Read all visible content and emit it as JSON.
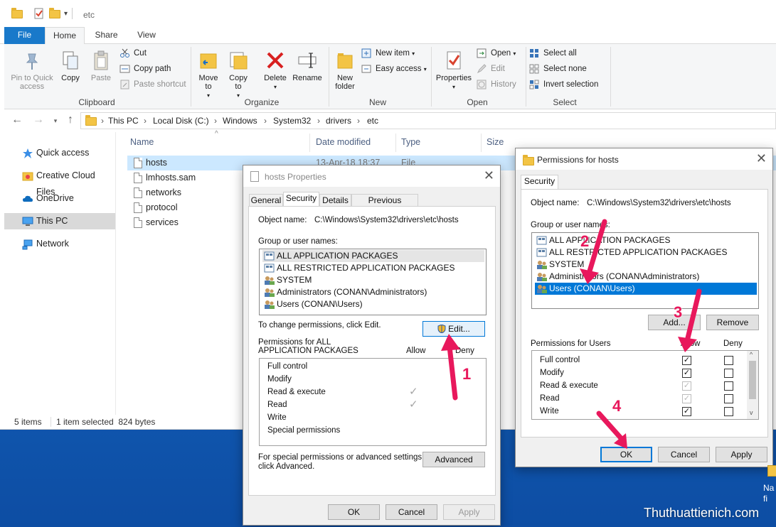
{
  "titlebar": {
    "path_text": "etc"
  },
  "ribbon_tabs": [
    "File",
    "Home",
    "Share",
    "View"
  ],
  "clipboard": {
    "pin_label": "Pin to Quick access",
    "copy_label": "Copy",
    "paste_label": "Paste",
    "cut_label": "Cut",
    "copy_path_label": "Copy path",
    "paste_shortcut_label": "Paste shortcut",
    "group_label": "Clipboard"
  },
  "organize": {
    "move_to_label": "Move to",
    "copy_to_label": "Copy to",
    "delete_label": "Delete",
    "rename_label": "Rename",
    "group_label": "Organize"
  },
  "new_group": {
    "new_folder_label": "New folder",
    "new_item_label": "New item",
    "easy_access_label": "Easy access",
    "group_label": "New"
  },
  "open_group": {
    "properties_label": "Properties",
    "open_label": "Open",
    "edit_label": "Edit",
    "history_label": "History",
    "group_label": "Open"
  },
  "select_group": {
    "select_all_label": "Select all",
    "select_none_label": "Select none",
    "invert_label": "Invert selection",
    "group_label": "Select"
  },
  "breadcrumb": [
    "This PC",
    "Local Disk (C:)",
    "Windows",
    "System32",
    "drivers",
    "etc"
  ],
  "nav": [
    {
      "label": "Quick access"
    },
    {
      "label": "Creative Cloud Files"
    },
    {
      "label": "OneDrive"
    },
    {
      "label": "This PC"
    },
    {
      "label": "Network"
    }
  ],
  "columns": {
    "name": "Name",
    "date": "Date modified",
    "type": "Type",
    "size": "Size"
  },
  "files": [
    {
      "name": "hosts",
      "date": "13-Apr-18 18:37",
      "type": "File"
    },
    {
      "name": "lmhosts.sam"
    },
    {
      "name": "networks"
    },
    {
      "name": "protocol"
    },
    {
      "name": "services"
    }
  ],
  "status": {
    "items": "5 items",
    "selection": "1 item selected  824 bytes"
  },
  "props_dialog": {
    "title": "hosts Properties",
    "tabs": [
      "General",
      "Security",
      "Details",
      "Previous Versions"
    ],
    "object_label": "Object name:",
    "object_value": "C:\\Windows\\System32\\drivers\\etc\\hosts",
    "group_label": "Group or user names:",
    "users": [
      "ALL APPLICATION PACKAGES",
      "ALL RESTRICTED APPLICATION PACKAGES",
      "SYSTEM",
      "Administrators (CONAN\\Administrators)",
      "Users (CONAN\\Users)"
    ],
    "change_text": "To change permissions, click Edit.",
    "edit_label": "Edit...",
    "perm_label_1": "Permissions for ALL",
    "perm_label_2": "APPLICATION PACKAGES",
    "allow_label": "Allow",
    "deny_label": "Deny",
    "perms": [
      "Full control",
      "Modify",
      "Read & execute",
      "Read",
      "Write",
      "Special permissions"
    ],
    "special_text_1": "For special permissions or advanced settings,",
    "special_text_2": "click Advanced.",
    "advanced_label": "Advanced",
    "ok_label": "OK",
    "cancel_label": "Cancel",
    "apply_label": "Apply"
  },
  "perm_dialog": {
    "title": "Permissions for hosts",
    "tab": "Security",
    "object_label": "Object name:",
    "object_value": "C:\\Windows\\System32\\drivers\\etc\\hosts",
    "group_label": "Group or user names:",
    "users": [
      "ALL APPLICATION PACKAGES",
      "ALL RESTRICTED APPLICATION PACKAGES",
      "SYSTEM",
      "Administrators (CONAN\\Administrators)",
      "Users (CONAN\\Users)"
    ],
    "add_label": "Add...",
    "remove_label": "Remove",
    "perm_label": "Permissions for Users",
    "allow_label": "Allow",
    "deny_label": "Deny",
    "perms": [
      "Full control",
      "Modify",
      "Read & execute",
      "Read",
      "Write"
    ],
    "ok_label": "OK",
    "cancel_label": "Cancel",
    "apply_label": "Apply"
  },
  "steps": [
    "1",
    "2",
    "3",
    "4"
  ],
  "watermark": "Thuthuattienich.com",
  "desktop_label": "Na fi",
  "colors": {
    "accent": "#1979ca",
    "selection": "#0078d7",
    "arrow": "#e8185c"
  }
}
